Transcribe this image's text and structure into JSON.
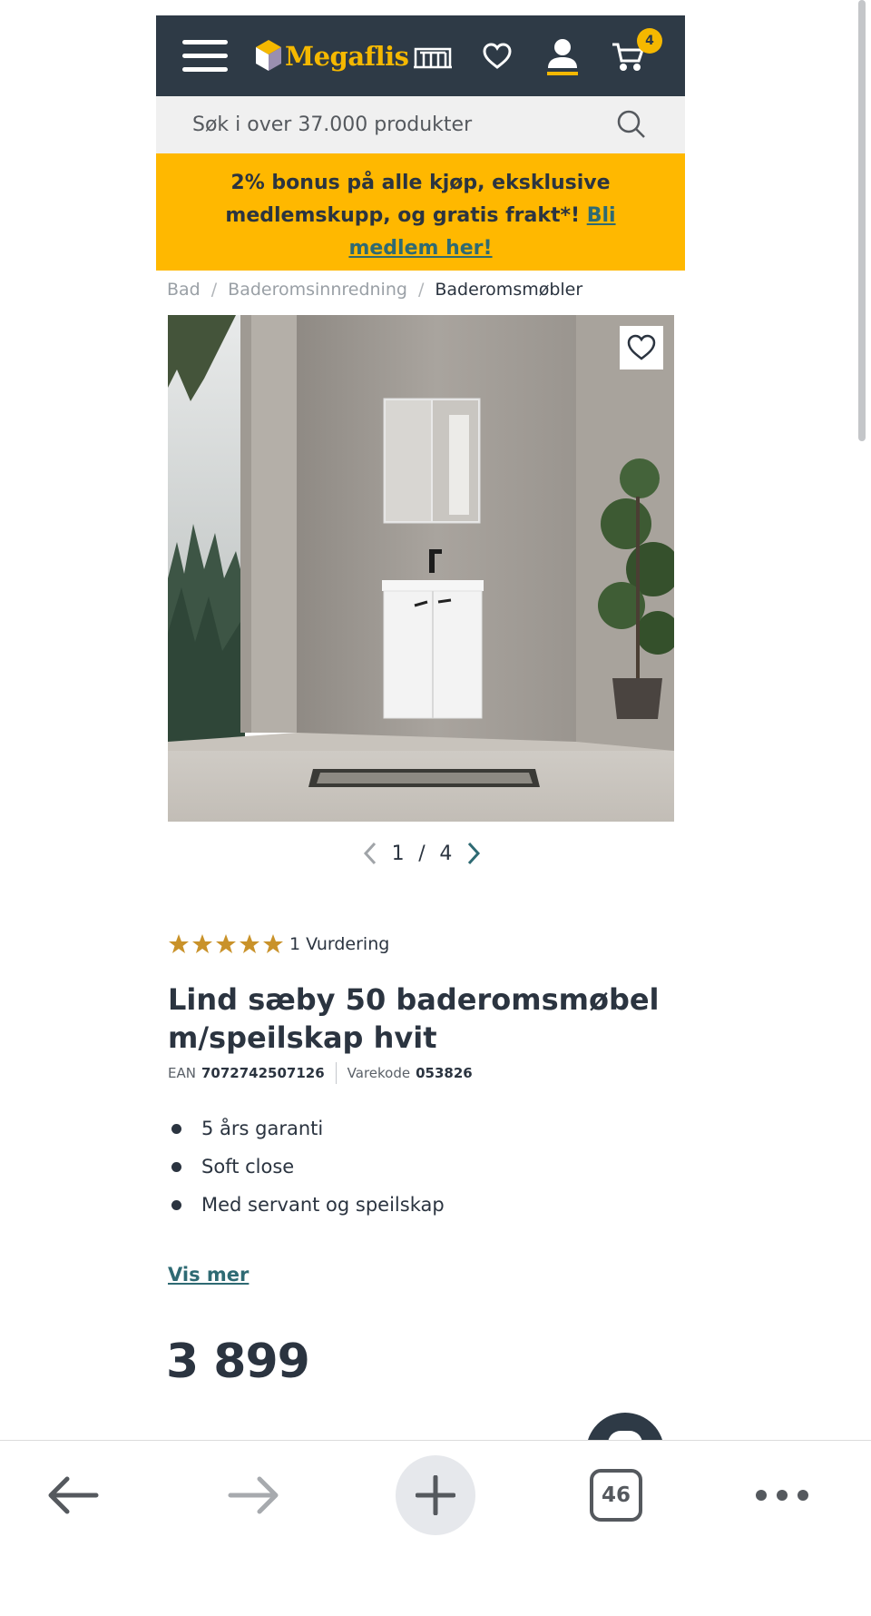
{
  "header": {
    "logo_text": "Megaflis",
    "cart_count": "4",
    "icons": [
      "menu-icon",
      "showroom-icon",
      "heart-icon",
      "user-icon",
      "cart-icon"
    ],
    "brand_color": "#2e3a46",
    "accent_color": "#f5b800"
  },
  "search": {
    "placeholder": "Søk i over 37.000 produkter"
  },
  "promo": {
    "text": "2% bonus på alle kjøp, eksklusive medlemskupp, og gratis frakt*!",
    "link": "Bli medlem her!",
    "background": "#ffb800"
  },
  "breadcrumb": {
    "items": [
      "Bad",
      "Baderomsinnredning",
      "Baderomsmøbler"
    ],
    "separator": "/"
  },
  "gallery": {
    "current": "1",
    "separator": "/",
    "total": "4"
  },
  "product": {
    "rating_stars": 5,
    "reviews": "1 Vurdering",
    "title": "Lind sæby 50 baderomsmøbel m/speilskap hvit",
    "ean_label": "EAN",
    "ean": "7072742507126",
    "code_label": "Varekode",
    "code": "053826",
    "features": [
      "5 års garanti",
      "Soft close",
      "Med servant og speilskap"
    ],
    "more_link": "Vis mer",
    "price": "3 899"
  },
  "browser": {
    "tab_count": "46",
    "icons": [
      "back-icon",
      "forward-icon",
      "new-tab-icon",
      "tabs-icon",
      "more-icon"
    ]
  }
}
